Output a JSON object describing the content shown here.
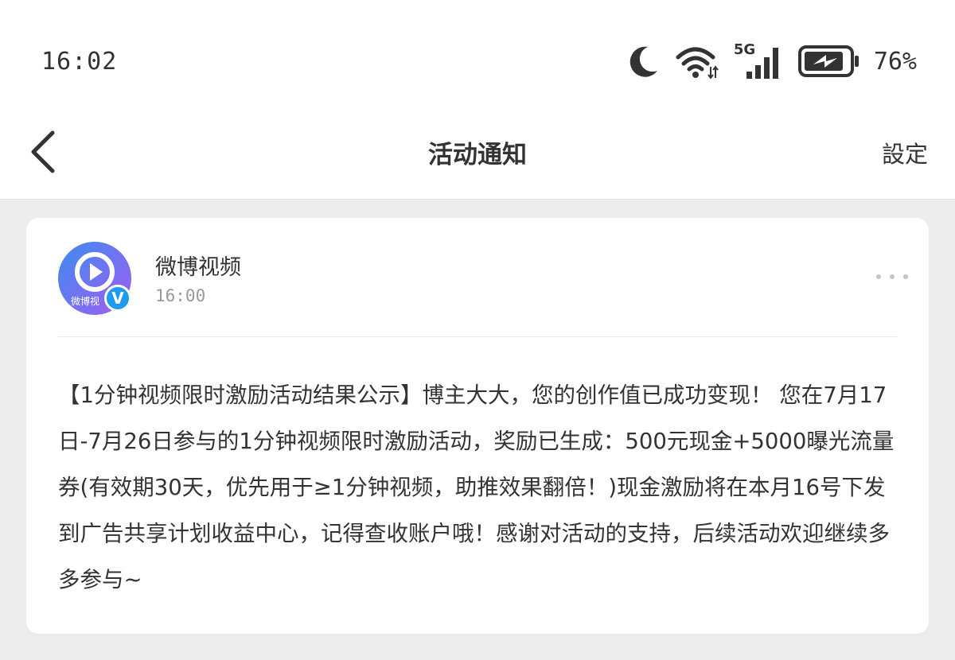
{
  "status_bar": {
    "time": "16:02",
    "network": "5G",
    "battery_percent": "76%",
    "icons": [
      "moon-icon",
      "wifi-icon",
      "cellular-signal-icon",
      "battery-charging-icon"
    ]
  },
  "nav": {
    "title": "活动通知",
    "settings_label": "設定"
  },
  "notification": {
    "sender": "微博视频",
    "time": "16:00",
    "avatar_label": "微博视",
    "verified_badge": "V",
    "message": "【1分钟视频限时激励活动结果公示】博主大大，您的创作值已成功变现！ 您在7月17日-7月26日参与的1分钟视频限时激励活动，奖励已生成：500元现金+5000曝光流量券(有效期30天，优先用于≥1分钟视频，助推效果翻倍！)现金激励将在本月16号下发到广告共享计划收益中心，记得查收账户哦！感谢对活动的支持，后续活动欢迎继续多多参与~"
  },
  "colors": {
    "background": "#ececec",
    "card": "#ffffff",
    "verified_badge": "#1d9bf0",
    "avatar_gradient_start": "#3c8cf0",
    "avatar_gradient_end": "#a25cf0"
  }
}
